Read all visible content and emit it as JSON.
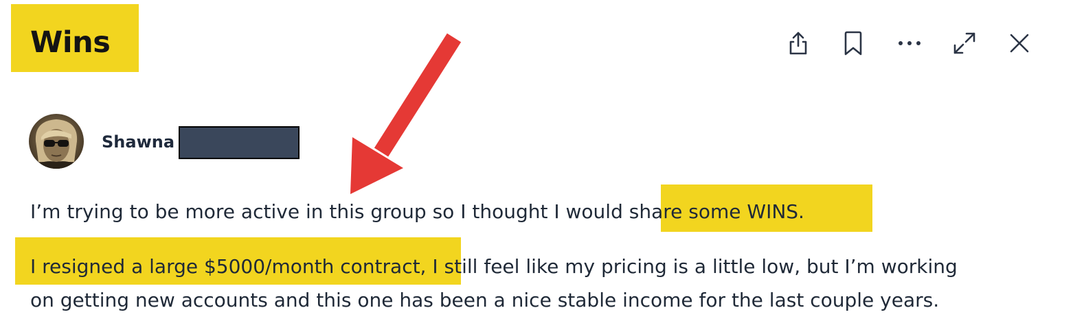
{
  "header": {
    "title": "Wins"
  },
  "toolbar": {
    "icons": [
      "share-icon",
      "bookmark-icon",
      "more-icon",
      "expand-icon",
      "close-icon"
    ]
  },
  "post": {
    "author_first_name": "Shawna",
    "line1_plain": "I’m trying to be more active in this group so I thought I would ",
    "line1_highlight": "share some WINS.",
    "line2_highlight": "I resigned a large $5000/month contract,",
    "line2_plain": " I still feel like my pricing is a little low, but I’m working",
    "line3": "on getting new accounts and this one has been a nice stable income for the last couple years."
  },
  "colors": {
    "highlight": "#f2d51f",
    "arrow": "#e53935",
    "text": "#1f2937",
    "redaction": "#3a475b"
  }
}
